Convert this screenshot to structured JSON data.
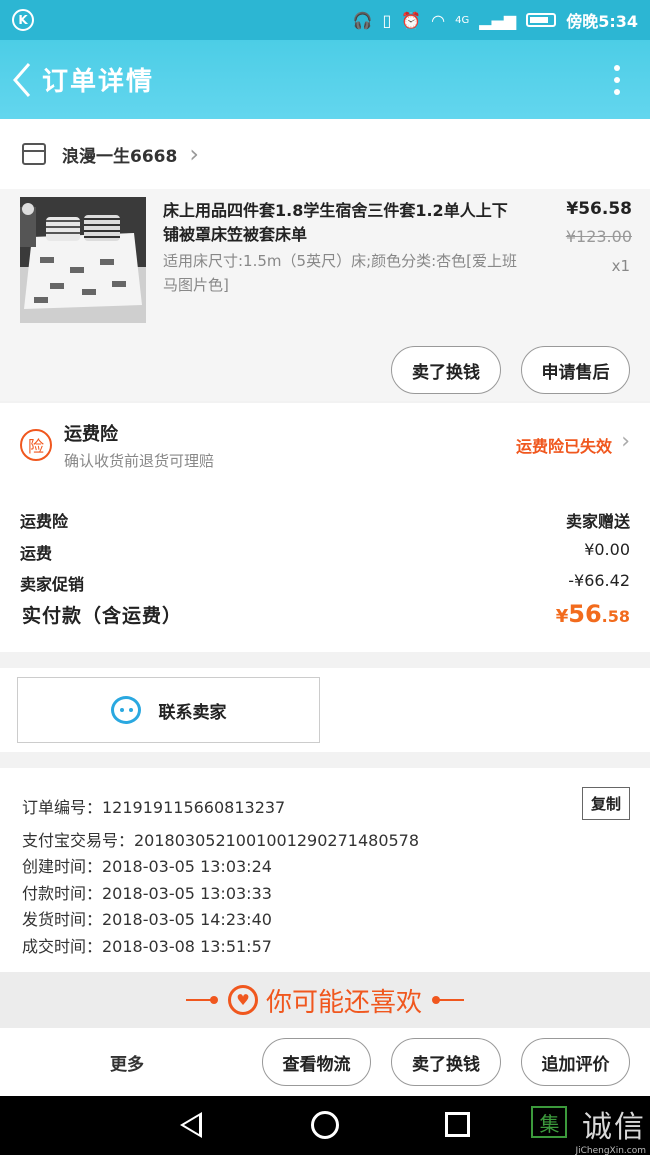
{
  "status_bar": {
    "time": "傍晚5:34",
    "network": "4G"
  },
  "header": {
    "title": "订单详情"
  },
  "shop": {
    "name": "浪漫一生6668"
  },
  "product": {
    "title": "床上用品四件套1.8学生宿舍三件套1.2单人上下铺被罩床笠被套床单",
    "spec": "适用床尺寸:1.5m（5英尺）床;颜色分类:杏色[爱上班马图片色]",
    "price": "¥56.58",
    "original_price": "¥123.00",
    "quantity": "x1",
    "btn_resell": "卖了换钱",
    "btn_aftersale": "申请售后"
  },
  "insurance": {
    "icon_text": "险",
    "title": "运费险",
    "subtitle": "确认收货前退货可理赔",
    "status": "运费险已失效"
  },
  "costs": {
    "rows": [
      {
        "label": "运费险",
        "value": "卖家赠送"
      },
      {
        "label": "运费",
        "value": "¥0.00"
      },
      {
        "label": "卖家促销",
        "value": "-¥66.42"
      }
    ],
    "total_label": "实付款（含运费）",
    "total_currency": "¥",
    "total_int": "56",
    "total_dec": ".58"
  },
  "contact": {
    "label": "联系卖家"
  },
  "order_info": {
    "lines": [
      "订单编号：121919115660813237",
      "支付宝交易号：2018030521001001290271480578",
      "创建时间：2018-03-05 13:03:24",
      "付款时间：2018-03-05 13:03:33",
      "发货时间：2018-03-05 14:23:40",
      "成交时间：2018-03-08 13:51:57"
    ],
    "copy_label": "复制"
  },
  "recommend": {
    "title": "你可能还喜欢"
  },
  "bottom": {
    "more": "更多",
    "btn_logistics": "查看物流",
    "btn_resell": "卖了换钱",
    "btn_review": "追加评价"
  },
  "watermark": {
    "text": "诚信",
    "mark": "集",
    "url": "JiChengXin.com"
  },
  "colors": {
    "accent": "#4ccde6",
    "orange": "#f0571e"
  },
  "icons": [
    "back-icon",
    "more-icon",
    "shop-icon",
    "chevron-right-icon",
    "insurance-icon",
    "chat-icon",
    "heart-icon",
    "nav-back-icon",
    "nav-home-icon",
    "nav-recent-icon"
  ]
}
